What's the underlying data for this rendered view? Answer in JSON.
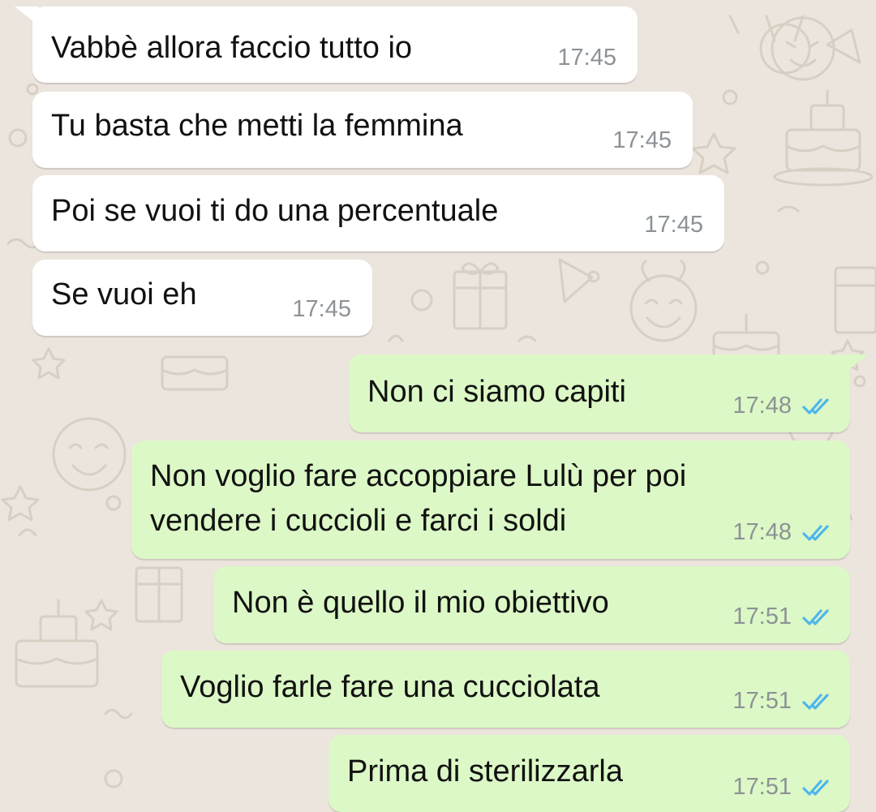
{
  "colors": {
    "wallpaper": "#ece5dd",
    "incoming_bubble": "#ffffff",
    "outgoing_bubble": "#dcf8c6",
    "read_ticks": "#4fb6ec",
    "timestamp": "#8c9296"
  },
  "icons": {
    "read_status": "double-check-icon"
  },
  "messages": [
    {
      "text": "Vabbè allora faccio tutto io",
      "time": "17:45",
      "direction": "in"
    },
    {
      "text": "Tu basta che metti la femmina",
      "time": "17:45",
      "direction": "in"
    },
    {
      "text": "Poi se vuoi ti do una percentuale",
      "time": "17:45",
      "direction": "in"
    },
    {
      "text": "Se vuoi eh",
      "time": "17:45",
      "direction": "in"
    },
    {
      "text": "Non ci siamo capiti",
      "time": "17:48",
      "direction": "out",
      "status": "read"
    },
    {
      "text": "Non voglio fare accoppiare Lulù per poi\nvendere i cuccioli e farci i soldi",
      "time": "17:48",
      "direction": "out",
      "status": "read"
    },
    {
      "text": "Non è quello il mio obiettivo",
      "time": "17:51",
      "direction": "out",
      "status": "read"
    },
    {
      "text": "Voglio farle fare una cucciolata",
      "time": "17:51",
      "direction": "out",
      "status": "read"
    },
    {
      "text": "Prima di sterilizzarla",
      "time": "17:51",
      "direction": "out",
      "status": "read"
    }
  ]
}
